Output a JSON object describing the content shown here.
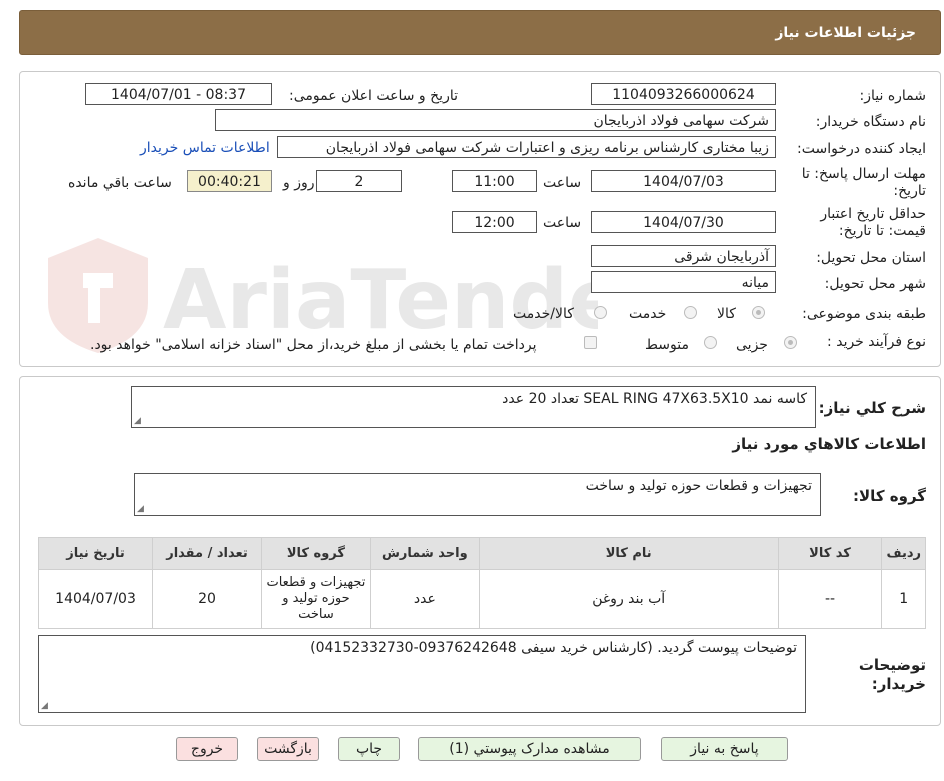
{
  "header": {
    "title": "جزئیات اطلاعات نیاز"
  },
  "form": {
    "need_number_label": "شماره نیاز:",
    "need_number": "1104093266000624",
    "announce_label": "تاریخ و ساعت اعلان عمومی:",
    "announce_value": "1404/07/01 - 08:37",
    "buyer_org_label": "نام دستگاه خریدار:",
    "buyer_org": "شرکت سهامی فولاد اذربایجان",
    "creator_label": "ایجاد کننده درخواست:",
    "creator": "زیبا مختاری کارشناس برنامه ریزی و اعتبارات شرکت سهامی فولاد اذربایجان",
    "contact_link": "اطلاعات تماس خریدار",
    "deadline_label": "مهلت ارسال پاسخ: تا تاریخ:",
    "deadline_date": "1404/07/03",
    "time_label": "ساعت",
    "deadline_time": "11:00",
    "days_value": "2",
    "days_label": "روز و",
    "remaining_time": "00:40:21",
    "remaining_label": "ساعت باقي مانده",
    "validity_label": "حداقل تاریخ اعتبار قیمت: تا تاریخ:",
    "validity_date": "1404/07/30",
    "validity_time": "12:00",
    "province_label": "استان محل تحویل:",
    "province": "آذربایجان شرقی",
    "city_label": "شهر محل تحویل:",
    "city": "میانه",
    "category_label": "طبقه بندی موضوعی:",
    "category_options": [
      "کالا",
      "خدمت",
      "کالا/خدمت"
    ],
    "category_selected": "کالا",
    "process_label": "نوع فرآیند خرید :",
    "process_options": [
      "جزیی",
      "متوسط"
    ],
    "process_selected": "جزیی",
    "payment_note": "پرداخت تمام یا بخشی از مبلغ خرید،از محل \"اسناد خزانه اسلامی\" خواهد بود."
  },
  "details": {
    "description_label": "شرح کلي نیاز:",
    "description": "کاسه نمد SEAL RING 47X63.5X10 تعداد 20 عدد",
    "goods_info_title": "اطلاعات کالاهاي مورد نیاز",
    "goods_group_label": "گروه کالا:",
    "goods_group": "تجهیزات و قطعات حوزه تولید و ساخت",
    "table": {
      "headers": [
        "ردیف",
        "کد کالا",
        "نام کالا",
        "واحد شمارش",
        "گروه کالا",
        "تعداد / مقدار",
        "تاریخ نیاز"
      ],
      "rows": [
        [
          "1",
          "--",
          "آب بند روغن",
          "عدد",
          "تجهیزات و قطعات حوزه تولید و ساخت",
          "20",
          "1404/07/03"
        ]
      ]
    },
    "buyer_notes_label": "توضیحات خریدار:",
    "buyer_notes": "توضیحات پیوست گردید. (کارشناس خرید سیفی 09376242648-04152332730)"
  },
  "buttons": {
    "reply": "پاسخ به نیاز",
    "attachments": "مشاهده مدارک پیوستي (1)",
    "print": "چاپ",
    "back": "بازگشت",
    "exit": "خروج"
  },
  "watermark": {
    "text": "AriaTender.neT",
    "color": "#c0392b"
  }
}
